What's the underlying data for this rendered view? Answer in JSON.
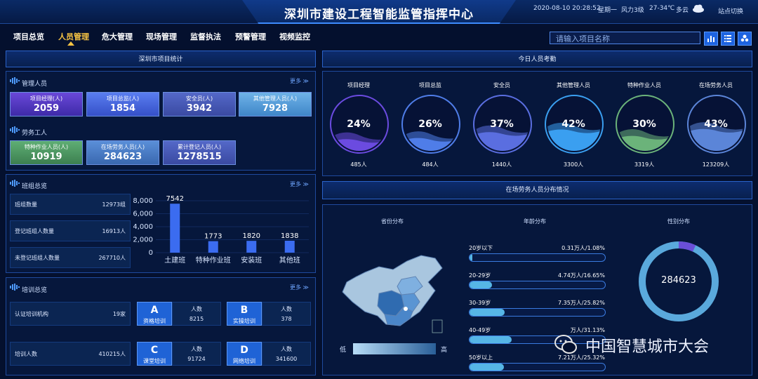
{
  "header": {
    "title": "深圳市建设工程智能监管指挥中心",
    "datetime": "2020-08-10 20:28:52",
    "weekday": "星期一",
    "wind": "风力3级",
    "temp": "27-34℃",
    "weather": "多云",
    "site_switch": "站点切换"
  },
  "nav": {
    "items": [
      "项目总览",
      "人员管理",
      "危大管理",
      "现场管理",
      "监督执法",
      "预警管理",
      "视频监控"
    ],
    "active_index": 1
  },
  "search": {
    "placeholder": "请输入项目名称"
  },
  "left": {
    "stats_title": "深圳市项目统计",
    "more": "更多",
    "managers": {
      "label": "管理人员",
      "cards": [
        {
          "label": "项目经理(人)",
          "value": "2059"
        },
        {
          "label": "项目总监(人)",
          "value": "1854"
        },
        {
          "label": "安全员(人)",
          "value": "3942"
        },
        {
          "label": "其他管理人员(人)",
          "value": "7928"
        }
      ]
    },
    "workers": {
      "label": "劳务工人",
      "cards": [
        {
          "label": "特种作业人员(人)",
          "value": "10919"
        },
        {
          "label": "在场劳务人员(人)",
          "value": "284623"
        },
        {
          "label": "累计登记人员(人)",
          "value": "1278515"
        }
      ]
    },
    "teams": {
      "label": "班组总览",
      "rows": [
        {
          "label": "班组数量",
          "value": "12973组"
        },
        {
          "label": "登记班组人数量",
          "value": "16913人"
        },
        {
          "label": "未登记班组人数量",
          "value": "267710人"
        }
      ]
    },
    "training": {
      "label": "培训总览",
      "rows": [
        {
          "label": "认证培训机构",
          "value": "19家"
        },
        {
          "label": "培训人数",
          "value": "410215人"
        }
      ],
      "types": [
        {
          "letter": "A",
          "name": "资格培训",
          "head": "人数",
          "value": "8215"
        },
        {
          "letter": "B",
          "name": "实操培训",
          "head": "人数",
          "value": "378"
        },
        {
          "letter": "C",
          "name": "课堂培训",
          "head": "人数",
          "value": "91724"
        },
        {
          "letter": "D",
          "name": "网络培训",
          "head": "人数",
          "value": "341600"
        }
      ]
    }
  },
  "chart_data": {
    "type": "bar",
    "categories": [
      "土建班",
      "特种作业班",
      "安装班",
      "其他班"
    ],
    "values": [
      7542,
      1773,
      1820,
      1838
    ],
    "ylim": [
      0,
      8000
    ],
    "yticks": [
      "0",
      "2,000",
      "4,000",
      "6,000",
      "8,000"
    ],
    "color": "#3b6cf0"
  },
  "attendance": {
    "title": "今日人员考勤",
    "items": [
      {
        "label": "项目经理",
        "pct": "24%",
        "count": "485人",
        "color": "#6b4be0"
      },
      {
        "label": "项目总监",
        "pct": "26%",
        "count": "484人",
        "color": "#4f7de8"
      },
      {
        "label": "安全员",
        "pct": "37%",
        "count": "1440人",
        "color": "#5a6ee0"
      },
      {
        "label": "其他管理人员",
        "pct": "42%",
        "count": "3300人",
        "color": "#3a9ff0"
      },
      {
        "label": "特种作业人员",
        "pct": "30%",
        "count": "3319人",
        "color": "#6bb37a"
      },
      {
        "label": "在场劳务人员",
        "pct": "43%",
        "count": "123209人",
        "color": "#5b85d8"
      }
    ]
  },
  "distribution": {
    "title": "在场劳务人员分布情况",
    "province_title": "省份分布",
    "legend_low": "低",
    "legend_high": "高",
    "age_title": "年龄分布",
    "ages": [
      {
        "label": "20岁以下",
        "value": "0.31万人/1.08%",
        "pct": 1.08
      },
      {
        "label": "20-29岁",
        "value": "4.74万人/16.65%",
        "pct": 16.65
      },
      {
        "label": "30-39岁",
        "value": "7.35万人/25.82%",
        "pct": 25.82
      },
      {
        "label": "40-49岁",
        "value": "万人/31.13%",
        "pct": 31.13
      },
      {
        "label": "50岁以上",
        "value": "7.21万人/25.32%",
        "pct": 25.32
      }
    ],
    "gender_title": "性别分布",
    "gender_total": "284623",
    "gender_share": 0.93
  },
  "watermark": "中国智慧城市大会"
}
